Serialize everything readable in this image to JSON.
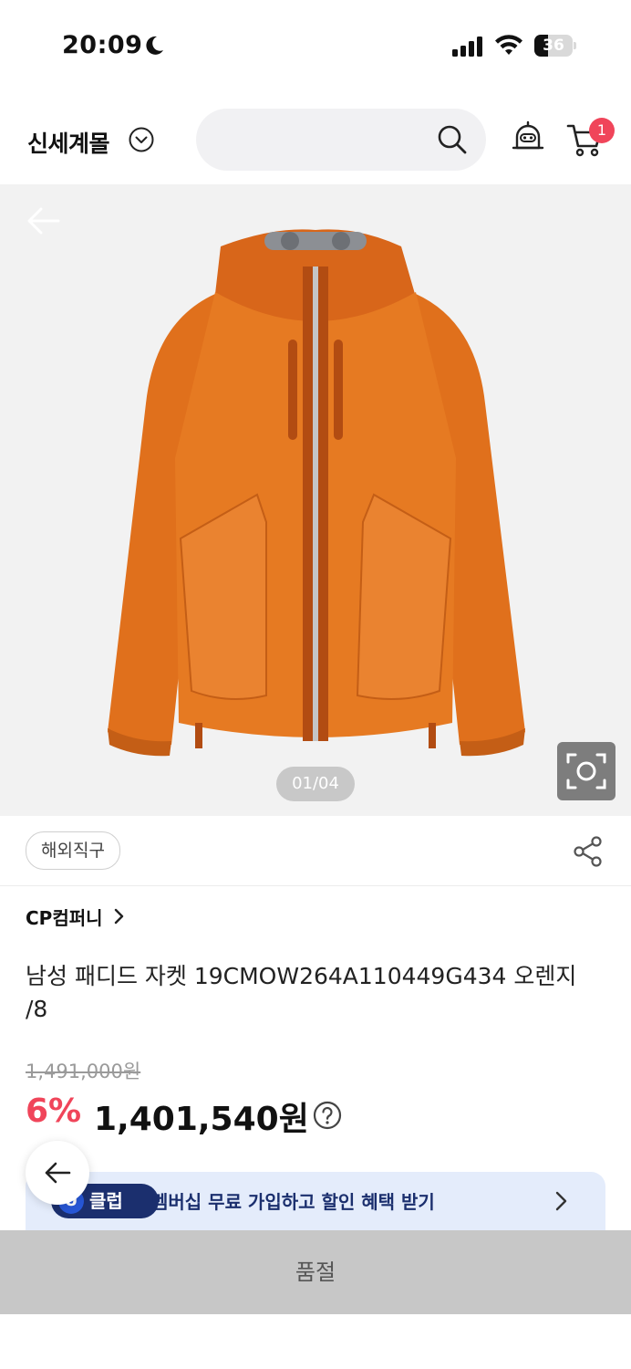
{
  "status_bar": {
    "time": "20:09",
    "battery": "36"
  },
  "header": {
    "brand": "신세계몰",
    "search_placeholder": "",
    "cart_count": "1"
  },
  "gallery": {
    "counter": "01/04"
  },
  "product": {
    "tag": "해외직구",
    "seller": "CP컴퍼니",
    "title": "남성 패디드 자켓 19CMOW264A110449G434 오렌지 /8",
    "original_price": "1,491,000원",
    "discount_rate": "6%",
    "sale_price": "1,401,540원"
  },
  "membership_banner": {
    "badge_u": "U",
    "badge_text": "클럽",
    "message": "멤버십 무료 가입하고 할인 혜택 받기"
  },
  "bottom_bar": {
    "label": "품절"
  },
  "colors": {
    "accent": "#f0455a",
    "jacket": "#e0701c",
    "banner_bg": "#e4ecfb",
    "uclub": "#1b2f6e"
  },
  "icons": [
    "moon-icon",
    "signal-icon",
    "wifi-icon",
    "battery-icon",
    "chevron-down-icon",
    "search-icon",
    "bell-bot-icon",
    "cart-icon",
    "back-arrow-icon",
    "camera-scan-icon",
    "share-icon",
    "chevron-right-icon",
    "help-icon"
  ]
}
